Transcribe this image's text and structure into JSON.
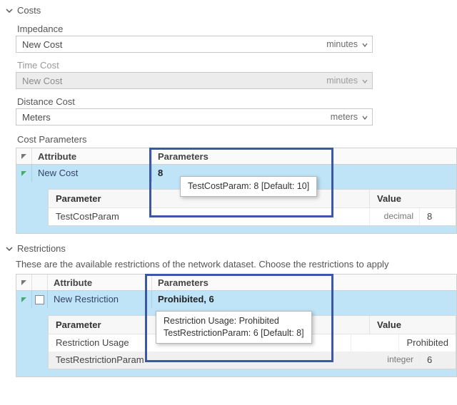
{
  "costs": {
    "title": "Costs",
    "impedance": {
      "label": "Impedance",
      "value": "New Cost",
      "unit": "minutes"
    },
    "timeCost": {
      "label": "Time Cost",
      "value": "New Cost",
      "unit": "minutes"
    },
    "distanceCost": {
      "label": "Distance Cost",
      "value": "Meters",
      "unit": "meters"
    },
    "costParams": {
      "label": "Cost Parameters",
      "headers": {
        "attribute": "Attribute",
        "parameters": "Parameters"
      },
      "row": {
        "attribute": "New Cost",
        "parameters": "8"
      },
      "nestedHeaders": {
        "parameter": "Parameter",
        "value": "Value"
      },
      "nestedRow": {
        "parameter": "TestCostParam",
        "type": "decimal",
        "value": "8"
      },
      "tooltip": "TestCostParam: 8 [Default: 10]"
    }
  },
  "restrictions": {
    "title": "Restrictions",
    "description": "These are the available restrictions of the network dataset. Choose the restrictions to apply",
    "headers": {
      "attribute": "Attribute",
      "parameters": "Parameters"
    },
    "row": {
      "attribute": "New Restriction",
      "parameters": "Prohibited, 6"
    },
    "nestedHeaders": {
      "parameter": "Parameter",
      "value": "Value"
    },
    "nestedRows": [
      {
        "parameter": "Restriction Usage",
        "type": "",
        "value": "Prohibited"
      },
      {
        "parameter": "TestRestrictionParam",
        "type": "integer",
        "value": "6"
      }
    ],
    "tooltip": "Restriction Usage: Prohibited\nTestRestrictionParam: 6 [Default: 8]"
  }
}
